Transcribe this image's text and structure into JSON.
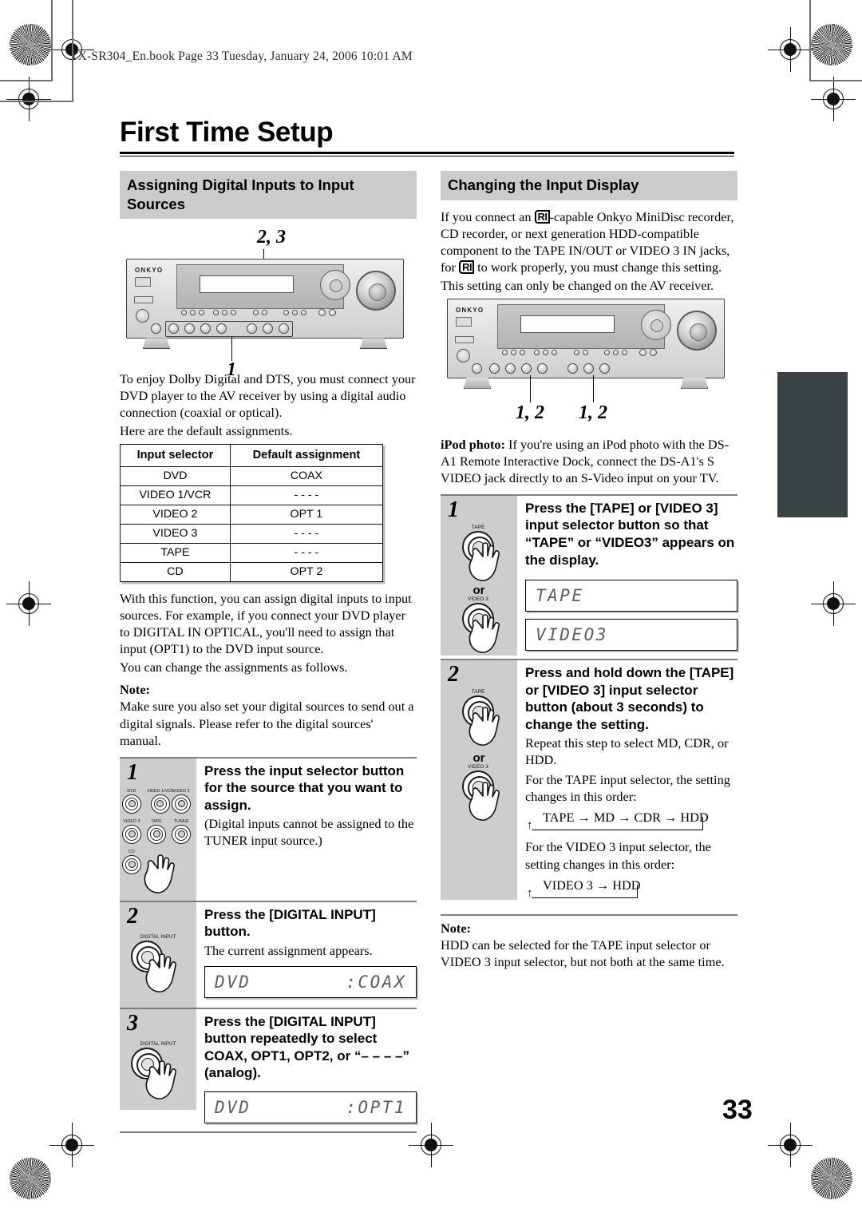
{
  "book_header": "TX-SR304_En.book  Page 33  Tuesday, January 24, 2006  10:01 AM",
  "page_title": "First Time Setup",
  "page_number": "33",
  "colors": {
    "section_header_bg": "#cbcbcb",
    "step_panel_bg": "#cdcdcd",
    "thumb_tab": "#3a4245",
    "lcd_text": "#5e5e5e"
  },
  "left_column": {
    "section_title": "Assigning Digital Inputs to Input Sources",
    "figure": {
      "callout_top": "2, 3",
      "callout_bottom": "1",
      "brand": "ONKYO"
    },
    "intro": [
      "To enjoy Dolby Digital and DTS, you must connect your DVD player to the AV receiver by using a digital audio connection (coaxial or optical).",
      "Here are the default assignments."
    ],
    "table": {
      "headers": [
        "Input selector",
        "Default assignment"
      ],
      "rows": [
        [
          "DVD",
          "COAX"
        ],
        [
          "VIDEO 1/VCR",
          "- - - -"
        ],
        [
          "VIDEO 2",
          "OPT 1"
        ],
        [
          "VIDEO 3",
          "- - - -"
        ],
        [
          "TAPE",
          "- - - -"
        ],
        [
          "CD",
          "OPT 2"
        ]
      ]
    },
    "after_table": [
      "With this function, you can assign digital inputs to input sources. For example, if you connect your DVD player to DIGITAL IN OPTICAL, you'll need to assign that input (OPT1) to the DVD input source.",
      "You can change the assignments as follows."
    ],
    "note_label": "Note:",
    "note_text": "Make sure you also set your digital sources to send out a digital signals. Please refer to the digital sources' manual.",
    "steps": [
      {
        "num": "1",
        "title": "Press the input selector button for the source that you want to assign.",
        "body": "(Digital inputs cannot be assigned to the TUNER input source.)",
        "button_labels": [
          "DVD",
          "VIDEO 1/VCR",
          "VIDEO 2",
          "VIDEO 3",
          "TAPE",
          "TUNER",
          "CD"
        ]
      },
      {
        "num": "2",
        "title": "Press the [DIGITAL INPUT] button.",
        "body": "The current assignment appears.",
        "button_labels": [
          "DIGITAL INPUT"
        ],
        "display_left": "DVD",
        "display_right": ":COAX"
      },
      {
        "num": "3",
        "title": "Press the [DIGITAL INPUT] button repeatedly to select COAX, OPT1, OPT2, or “– – – –” (analog).",
        "body": "",
        "button_labels": [
          "DIGITAL INPUT"
        ],
        "display_left": "DVD",
        "display_right": ":OPT1"
      }
    ]
  },
  "right_column": {
    "section_title": "Changing the Input Display",
    "intro_part1": "If you connect an ",
    "ri_symbol": "RI",
    "intro_part2": "-capable Onkyo MiniDisc recorder, CD recorder, or next generation HDD-compatible component to the TAPE IN/OUT or VIDEO 3 IN jacks, for ",
    "intro_part3": " to work properly, you must change this setting.",
    "intro_line2": "This setting can only be changed on the AV receiver.",
    "figure": {
      "callout_left": "1, 2",
      "callout_right": "1, 2",
      "brand": "ONKYO"
    },
    "ipod_label": "iPod photo:",
    "ipod_text": " If you're using an iPod photo with the DS-A1 Remote Interactive Dock, connect the DS-A1's S VIDEO jack directly to an S-Video input on your TV.",
    "steps": [
      {
        "num": "1",
        "title": "Press the [TAPE] or [VIDEO 3] input selector button so that “TAPE” or “VIDEO3” appears on the display.",
        "button_labels": [
          "TAPE",
          "VIDEO 3"
        ],
        "or_label": "or",
        "display_1": "TAPE",
        "display_2": "VIDEO3"
      },
      {
        "num": "2",
        "title": "Press and hold down the [TAPE] or [VIDEO 3] input selector button (about 3 seconds) to change the setting.",
        "button_labels": [
          "TAPE",
          "VIDEO 3"
        ],
        "or_label": "or",
        "body1": "Repeat this step to select MD, CDR, or HDD.",
        "body2": "For the TAPE input selector, the setting changes in this order:",
        "flow1": "TAPE → MD → CDR → HDD",
        "body3": "For the VIDEO 3 input selector, the setting changes in this order:",
        "flow2": "VIDEO 3 → HDD"
      }
    ],
    "note_label": "Note:",
    "note_text": "HDD can be selected for the TAPE input selector or VIDEO 3 input selector, but not both at the same time."
  }
}
